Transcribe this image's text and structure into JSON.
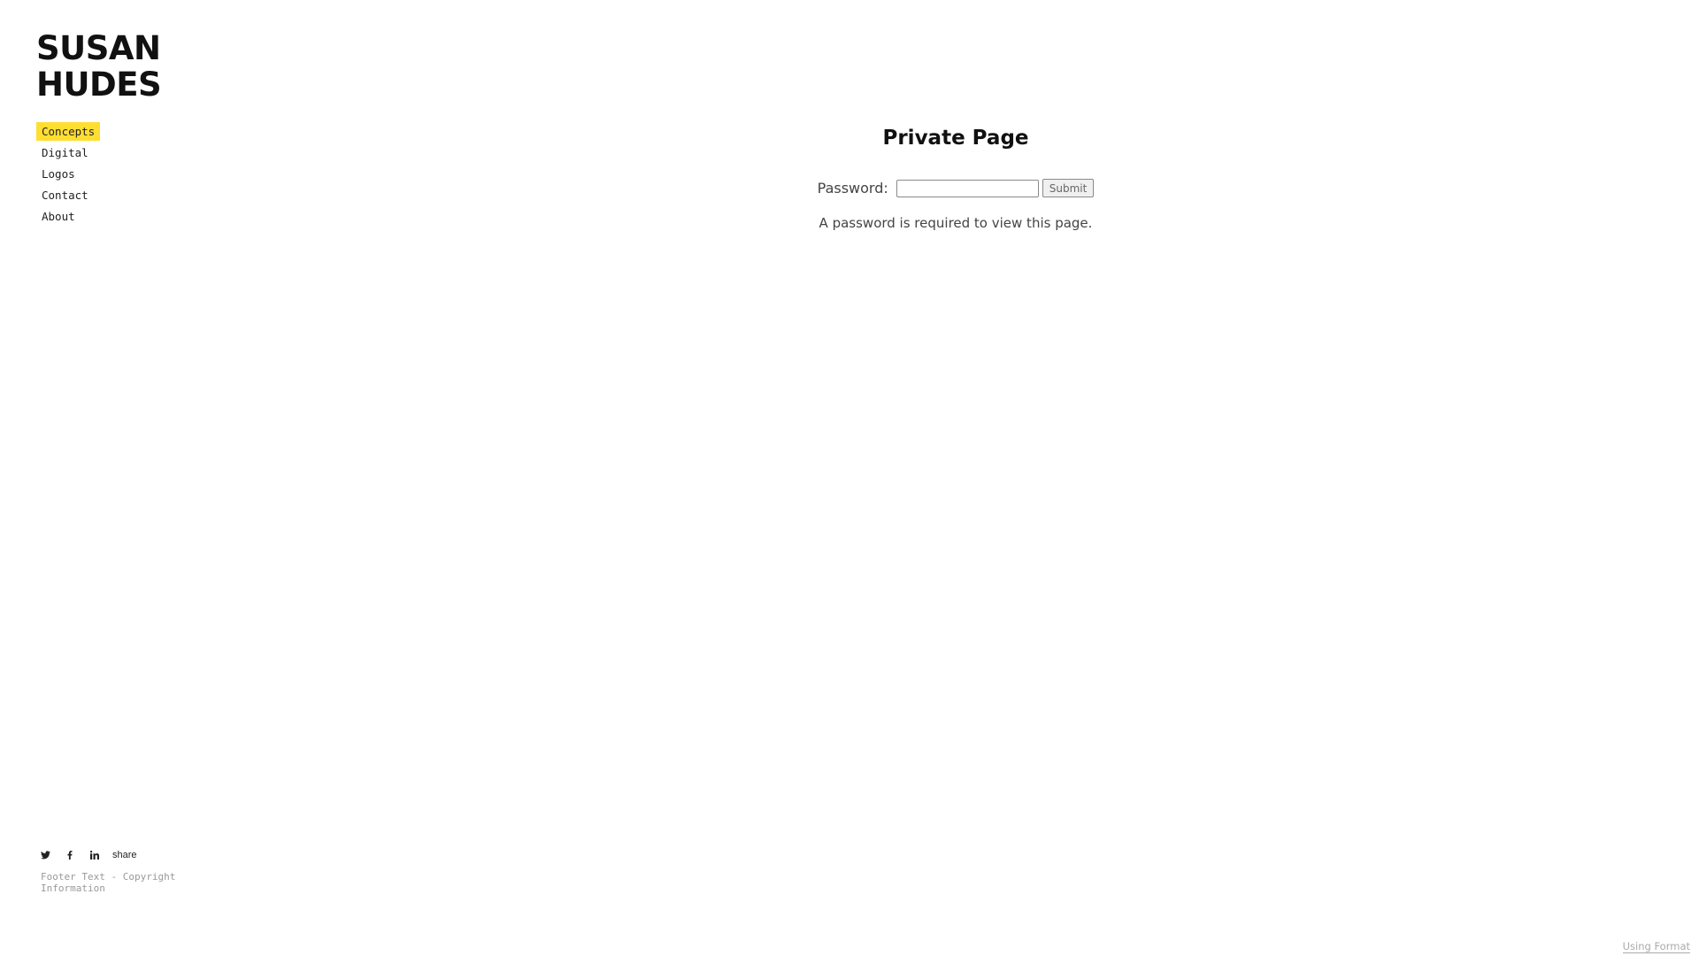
{
  "brand": {
    "line1": "SUSAN",
    "line2": "HUDES"
  },
  "nav": {
    "items": [
      {
        "label": "Concepts",
        "active": true
      },
      {
        "label": "Digital",
        "active": false
      },
      {
        "label": "Logos",
        "active": false
      },
      {
        "label": "Contact",
        "active": false
      },
      {
        "label": "About",
        "active": false
      }
    ]
  },
  "social": {
    "icons": [
      "twitter-icon",
      "facebook-icon",
      "linkedin-icon"
    ],
    "share_label": "share"
  },
  "footer": {
    "text": "Footer Text - Copyright Information"
  },
  "main": {
    "title": "Private Page",
    "password_label": "Password:",
    "password_value": "",
    "submit_label": "Submit",
    "note": "A password is required to view this page."
  },
  "badge": {
    "label": "Using Format"
  },
  "colors": {
    "nav_active_bg": "#ffde32",
    "text": "#111111",
    "muted": "#999999"
  }
}
